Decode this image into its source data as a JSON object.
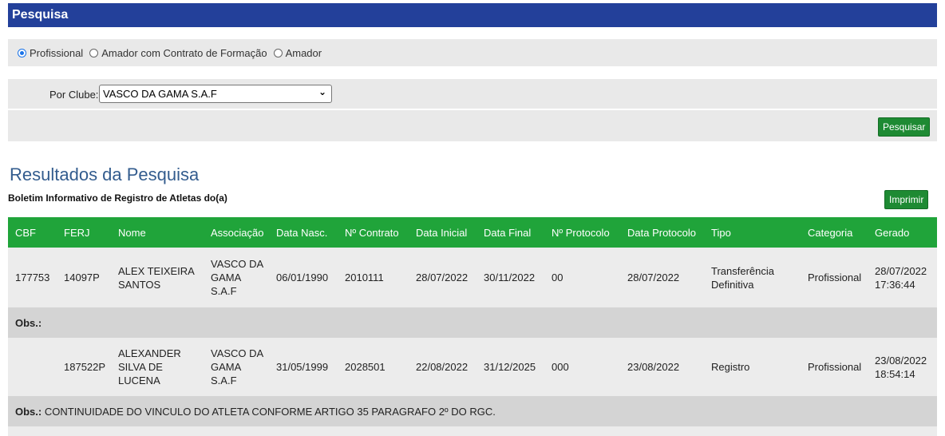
{
  "header": {
    "title": "Pesquisa"
  },
  "type_options": [
    {
      "label": "Profissional",
      "checked": true
    },
    {
      "label": "Amador com Contrato de Formação",
      "checked": false
    },
    {
      "label": "Amador",
      "checked": false
    }
  ],
  "club_filter": {
    "label": "Por Clube:",
    "selected": "VASCO DA GAMA S.A.F"
  },
  "search_button": "Pesquisar",
  "results": {
    "title": "Resultados da Pesquisa",
    "subtitle": "Boletim Informativo de Registro de Atletas do(a)",
    "print_button": "Imprimir",
    "columns": [
      "CBF",
      "FERJ",
      "Nome",
      "Associação",
      "Data Nasc.",
      "Nº Contrato",
      "Data Inicial",
      "Data Final",
      "Nº Protocolo",
      "Data Protocolo",
      "Tipo",
      "Categoria",
      "Gerado"
    ],
    "obs_label": "Obs.:",
    "rows": [
      {
        "cbf": "177753",
        "ferj": "14097P",
        "nome": "ALEX TEIXEIRA SANTOS",
        "associacao": "VASCO DA GAMA S.A.F",
        "data_nasc": "06/01/1990",
        "contrato": "2010111",
        "data_inicial": "28/07/2022",
        "data_final": "30/11/2022",
        "protocolo": "00",
        "data_protocolo": "28/07/2022",
        "tipo": "Transferência Definitiva",
        "categoria": "Profissional",
        "gerado": "28/07/2022 17:36:44",
        "obs": ""
      },
      {
        "cbf": "",
        "ferj": "187522P",
        "nome": "ALEXANDER SILVA DE LUCENA",
        "associacao": "VASCO DA GAMA S.A.F",
        "data_nasc": "31/05/1999",
        "contrato": "2028501",
        "data_inicial": "22/08/2022",
        "data_final": "31/12/2025",
        "protocolo": "000",
        "data_protocolo": "23/08/2022",
        "tipo": "Registro",
        "categoria": "Profissional",
        "gerado": "23/08/2022 18:54:14",
        "obs": "CONTINUIDADE DO VINCULO DO ATLETA CONFORME ARTIGO 35 PARAGRAFO 2º DO RGC."
      }
    ]
  }
}
